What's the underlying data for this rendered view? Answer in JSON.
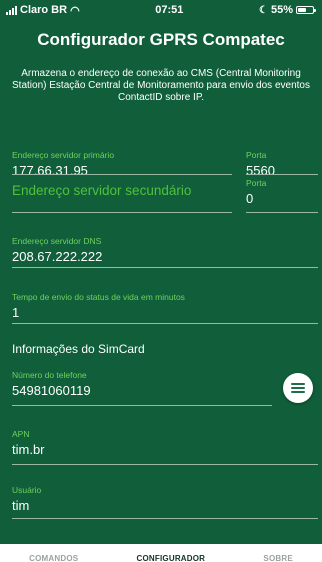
{
  "status_bar": {
    "carrier": "Claro BR",
    "time": "07:51",
    "battery": "55%",
    "battery_level": 0.55
  },
  "header": {
    "title": "Configurador GPRS Compatec",
    "description": "Armazena o endereço de conexão ao CMS (Central Monitoring Station) Estação Central de Monitoramento para envio dos eventos ContactID sobre IP."
  },
  "form": {
    "primary_server": {
      "label": "Endereço servidor primário",
      "value": "177.66.31.95"
    },
    "primary_port": {
      "label": "Porta",
      "value": "5560"
    },
    "secondary_server": {
      "placeholder": "Endereço servidor secundário"
    },
    "secondary_port": {
      "label": "Porta",
      "value": "0"
    },
    "dns_server": {
      "label": "Endereço servidor DNS",
      "value": "208.67.222.222"
    },
    "keepalive": {
      "label": "Tempo de envio do status de vida em minutos",
      "value": "1"
    },
    "simcard_section": "Informações do SimCard",
    "phone": {
      "label": "Número do telefone",
      "value": "54981060119"
    },
    "apn": {
      "label": "APN",
      "value": "tim.br"
    },
    "user": {
      "label": "Usuário",
      "value": "tim"
    }
  },
  "fab_icon": "menu-icon",
  "tabs": [
    {
      "label": "COMANDOS",
      "active": false
    },
    {
      "label": "CONFIGURADOR",
      "active": true
    },
    {
      "label": "SOBRE",
      "active": false
    }
  ],
  "colors": {
    "background": "#105f3a",
    "label": "#6fd15f",
    "placeholder": "#4fc13b",
    "tab_active": "#123326",
    "tab_inactive": "#9aa3a0"
  }
}
